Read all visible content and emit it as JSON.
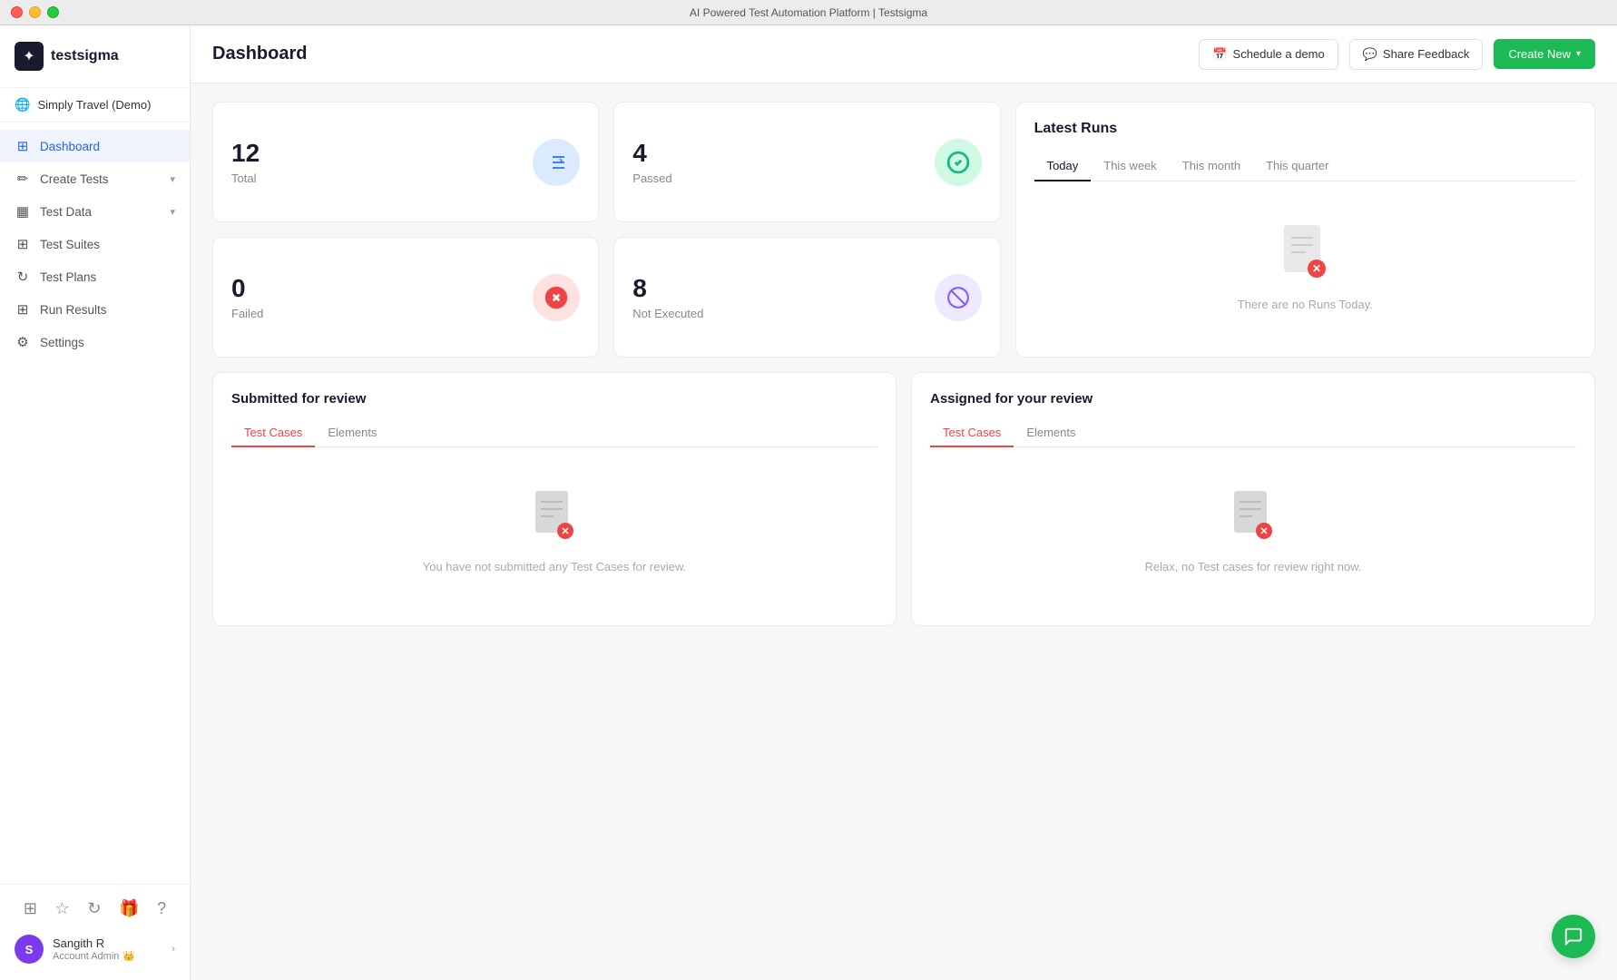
{
  "titlebar": {
    "title": "AI Powered Test Automation Platform | Testsigma"
  },
  "sidebar": {
    "logo_text": "testsigma",
    "project": "Simply Travel (Demo)",
    "nav_items": [
      {
        "id": "dashboard",
        "label": "Dashboard",
        "icon": "⊞",
        "active": true
      },
      {
        "id": "create-tests",
        "label": "Create Tests",
        "icon": "✏",
        "has_chevron": true
      },
      {
        "id": "test-data",
        "label": "Test Data",
        "icon": "⊟",
        "has_chevron": true
      },
      {
        "id": "test-suites",
        "label": "Test Suites",
        "icon": "⊞",
        "has_chevron": false
      },
      {
        "id": "test-plans",
        "label": "Test Plans",
        "icon": "↻",
        "has_chevron": false
      },
      {
        "id": "run-results",
        "label": "Run Results",
        "icon": "⊞",
        "has_chevron": false
      },
      {
        "id": "settings",
        "label": "Settings",
        "icon": "⚙",
        "has_chevron": false
      }
    ],
    "user": {
      "initial": "S",
      "name": "Sangith R",
      "role": "Account Admin"
    }
  },
  "header": {
    "title": "Dashboard",
    "schedule_demo": "Schedule a demo",
    "share_feedback": "Share Feedback",
    "create_new": "Create New"
  },
  "stats": [
    {
      "id": "total",
      "value": "12",
      "label": "Total",
      "icon_type": "total"
    },
    {
      "id": "passed",
      "value": "4",
      "label": "Passed",
      "icon_type": "passed"
    },
    {
      "id": "failed",
      "value": "0",
      "label": "Failed",
      "icon_type": "failed"
    },
    {
      "id": "not-executed",
      "value": "8",
      "label": "Not Executed",
      "icon_type": "notexec"
    }
  ],
  "latest_runs": {
    "title": "Latest Runs",
    "tabs": [
      "Today",
      "This week",
      "This month",
      "This quarter"
    ],
    "active_tab": "Today",
    "empty_message": "There are no Runs Today."
  },
  "review_sections": [
    {
      "id": "submitted",
      "title": "Submitted for review",
      "tabs": [
        "Test Cases",
        "Elements"
      ],
      "active_tab": "Test Cases",
      "empty_message": "You have not submitted any Test Cases for review."
    },
    {
      "id": "assigned",
      "title": "Assigned for your review",
      "tabs": [
        "Test Cases",
        "Elements"
      ],
      "active_tab": "Test Cases",
      "empty_message": "Relax, no Test cases for review right now."
    }
  ]
}
